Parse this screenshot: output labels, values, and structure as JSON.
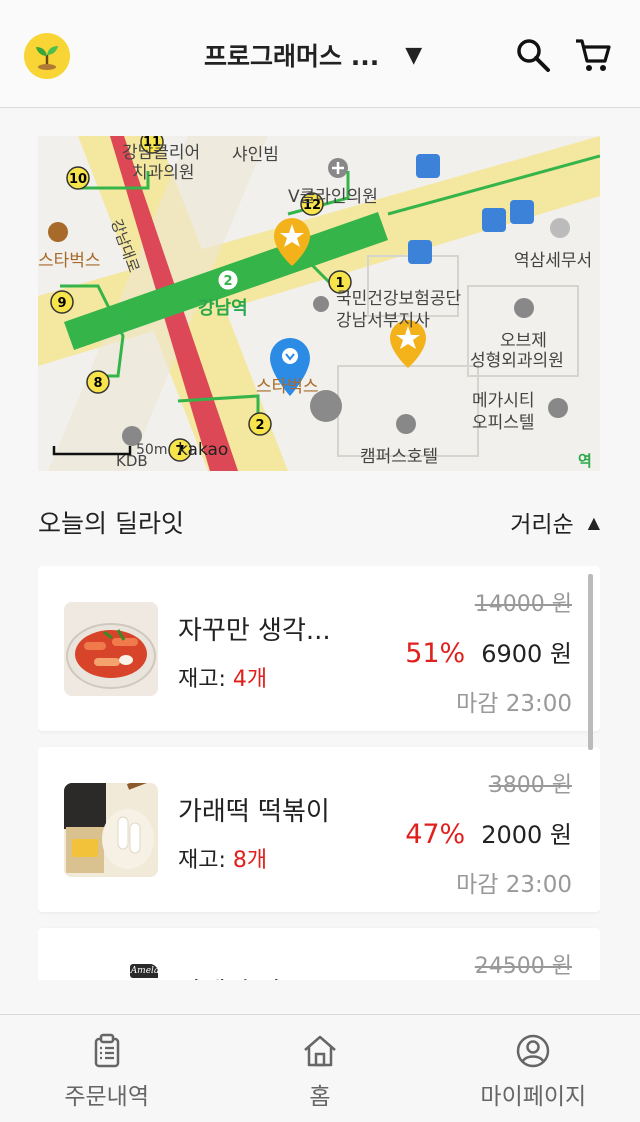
{
  "header": {
    "location": "프로그래머스 ...",
    "location_caret": "▼",
    "logo_icon": "sprout-icon",
    "search_icon": "search-icon",
    "cart_icon": "cart-icon"
  },
  "map": {
    "labels": {
      "clinic1": "강남클리어",
      "clinic1b": "치과의원",
      "signal": "샤인빔",
      "v_clinic": "V클라인의원",
      "starbucks1": "스타벅스",
      "road": "강남대로",
      "station": "강남역",
      "nhis1": "국민건강보험공단",
      "nhis2": "강남서부지사",
      "tax": "역삼세무서",
      "obje1": "오브제",
      "obje2": "성형외과의원",
      "mega1": "메가시티",
      "mega2": "오피스텔",
      "starbucks2": "스타벅스",
      "campus": "캠퍼스호텔",
      "kdb": "KDB",
      "scale": "50m",
      "kakao": "kakao",
      "station2_num": "2",
      "yeok": "역"
    },
    "exits": [
      "11",
      "10",
      "12",
      "9",
      "1",
      "8",
      "2",
      "7"
    ]
  },
  "section": {
    "title": "오늘의 딜라잇",
    "sort_label": "거리순",
    "sort_caret": "▲"
  },
  "deals": [
    {
      "name": "자꾸만 생각...",
      "stock_label": "재고: ",
      "stock_qty": "4개",
      "original_price": "14000 원",
      "discount": "51%",
      "price": "6900 원",
      "close_time": "마감 23:00"
    },
    {
      "name": "가래떡 떡볶이",
      "stock_label": "재고: ",
      "stock_qty": "8개",
      "original_price": "3800 원",
      "discount": "47%",
      "price": "2000 원",
      "close_time": "마감 23:00"
    },
    {
      "name": "아메리 마코",
      "original_price": "24500 원",
      "brand_mark": "Amela"
    }
  ],
  "bottom_nav": [
    {
      "label": "주문내역",
      "icon": "clipboard-icon"
    },
    {
      "label": "홈",
      "icon": "home-icon"
    },
    {
      "label": "마이페이지",
      "icon": "user-circle-icon"
    }
  ]
}
